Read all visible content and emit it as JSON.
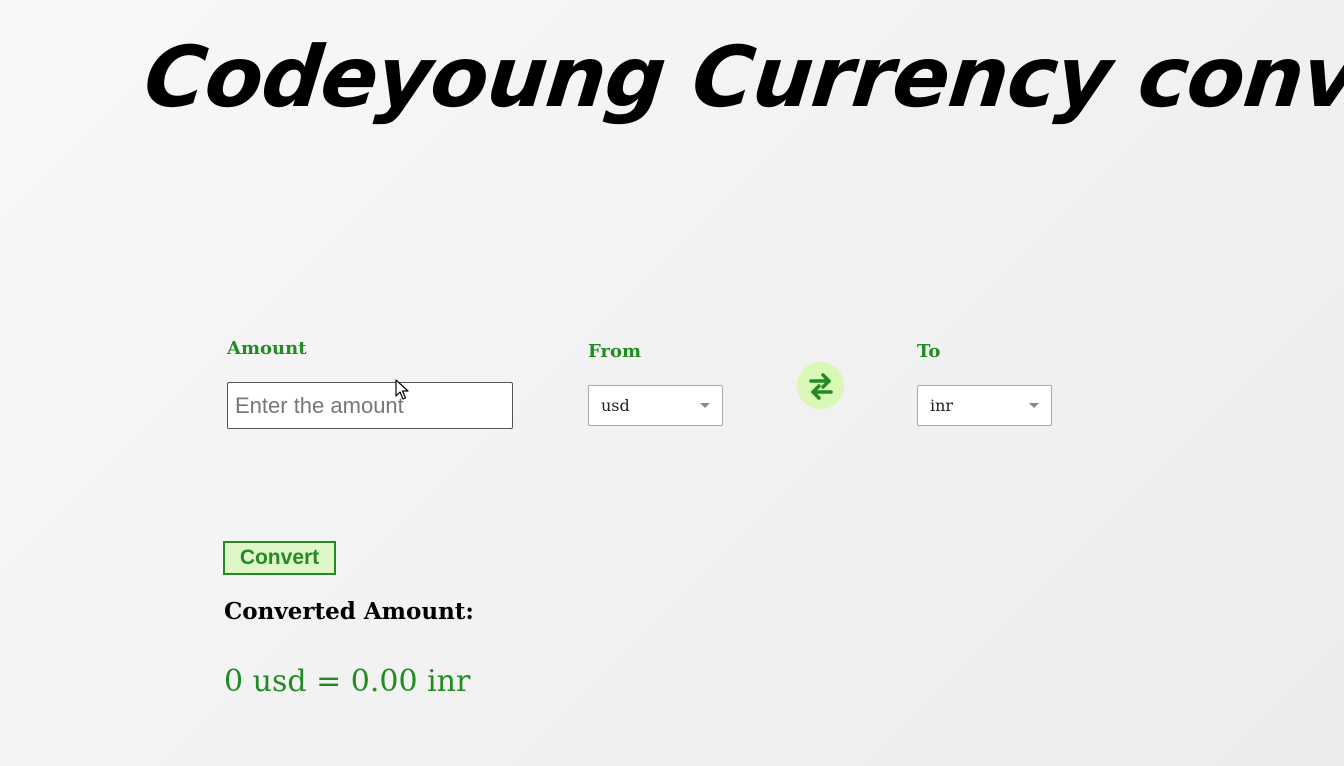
{
  "page": {
    "title": "Codeyoung Currency converter"
  },
  "form": {
    "amount_label": "Amount",
    "amount_placeholder": "Enter the amount",
    "amount_value": "",
    "from_label": "From",
    "from_value": "usd",
    "to_label": "To",
    "to_value": "inr",
    "swap_icon": "swap-arrows-icon",
    "convert_label": "Convert"
  },
  "result": {
    "label": "Converted Amount:",
    "text": "0 usd = 0.00 inr"
  },
  "colors": {
    "accent": "#228b22",
    "button_bg": "#dff7c8",
    "swap_bg": "#d9f7b5"
  }
}
